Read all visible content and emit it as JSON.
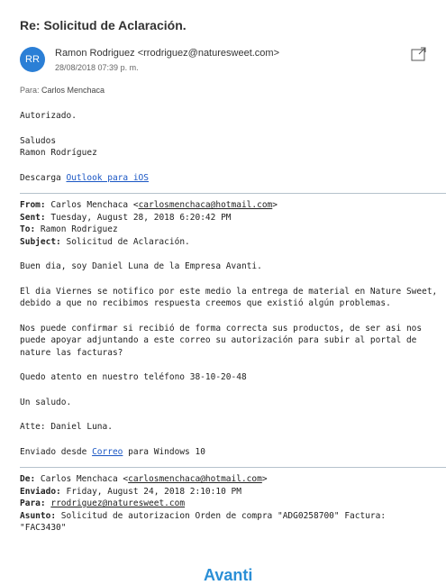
{
  "message": {
    "subject": "Re: Solicitud de Aclaración.",
    "avatar_initials": "RR",
    "sender": "Ramon Rodriguez <rrodriguez@naturesweet.com>",
    "date": "28/08/2018 07:39 p. m.",
    "to_label": "Para:",
    "to_name": "Carlos Menchaca",
    "colors": {
      "accent": "#2b7fd6",
      "link": "#1a56c4"
    }
  },
  "reply": {
    "line1": "Autorizado.",
    "line2": "Saludos",
    "line3": "Ramon Rodríguez",
    "download_prefix": "Descarga ",
    "download_link": "Outlook para iOS"
  },
  "quote1": {
    "from_label": "From:",
    "from_name": " Carlos Menchaca <",
    "from_email": "carlosmenchaca@hotmail.com",
    "from_close": ">",
    "sent_label": "Sent:",
    "sent_value": " Tuesday, August 28, 2018 6:20:42 PM",
    "to_label": "To:",
    "to_value": " Ramon Rodriguez",
    "subject_label": "Subject:",
    "subject_value": " Solicitud de Aclaración.",
    "p1": "Buen dia, soy Daniel Luna de la Empresa Avanti.",
    "p2": "El dia Viernes se notifico por este medio la entrega de material en Nature Sweet,\ndebido a que no recibimos respuesta creemos que existió algún problemas.",
    "p3": "Nos puede confirmar si recibió de forma correcta sus productos, de ser asi nos\npuede apoyar adjuntando a este correo su autorización para subir al portal de\nnature las facturas?",
    "p4": "Quedo atento en nuestro teléfono 38-10-20-48",
    "p5": "Un saludo.",
    "p6": "Atte: Daniel Luna.",
    "sent_from_prefix": "Enviado desde ",
    "sent_from_link": "Correo",
    "sent_from_suffix": " para Windows 10"
  },
  "quote2": {
    "from_label": "De:",
    "from_name": " Carlos Menchaca <",
    "from_email": "carlosmenchaca@hotmail.com",
    "from_close": ">",
    "sent_label": "Enviado:",
    "sent_value": " Friday, August 24, 2018 2:10:10 PM",
    "to_label": "Para:",
    "to_value": "rrodriguez@naturesweet.com",
    "subject_label": "Asunto:",
    "subject_value": " Solicitud de autorizacion Orden de compra \"ADG0258700\" Factura:\n\"FAC3430\""
  },
  "logo_text": "Avanti"
}
